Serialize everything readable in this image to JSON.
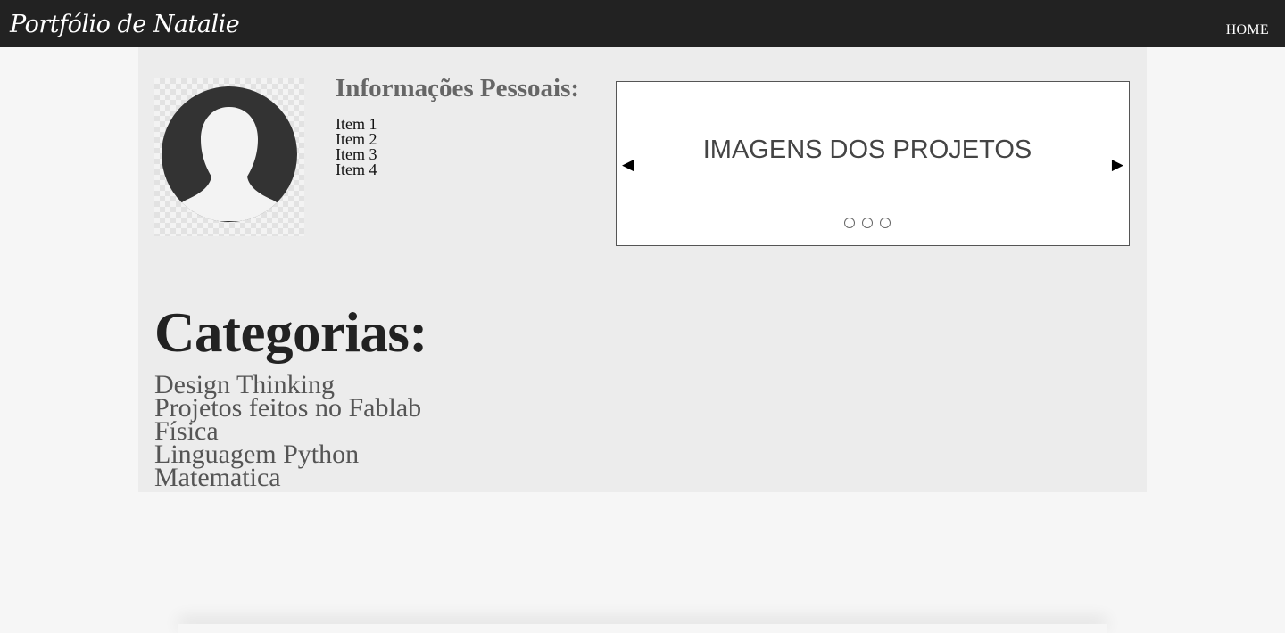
{
  "navbar": {
    "brand": "Portfólio de Natalie",
    "home_label": "HOME"
  },
  "profile": {
    "avatar_icon": "user-silhouette-icon",
    "info_title": "Informações Pessoais:",
    "items": [
      "Item 1",
      "Item 2",
      "Item 3",
      "Item 4"
    ]
  },
  "carousel": {
    "caption": "IMAGENS DOS PROJETOS",
    "prev_icon": "◀",
    "next_icon": "▶",
    "indicator_count": 3
  },
  "categories": {
    "title": "Categorias:",
    "items": [
      "Design Thinking",
      "Projetos feitos no Fablab",
      "Física",
      "Linguagem Python",
      "Matematica"
    ]
  },
  "colors": {
    "navbar_bg": "#222222",
    "page_bg": "#f6f6f6",
    "content_bg": "#ececec"
  }
}
